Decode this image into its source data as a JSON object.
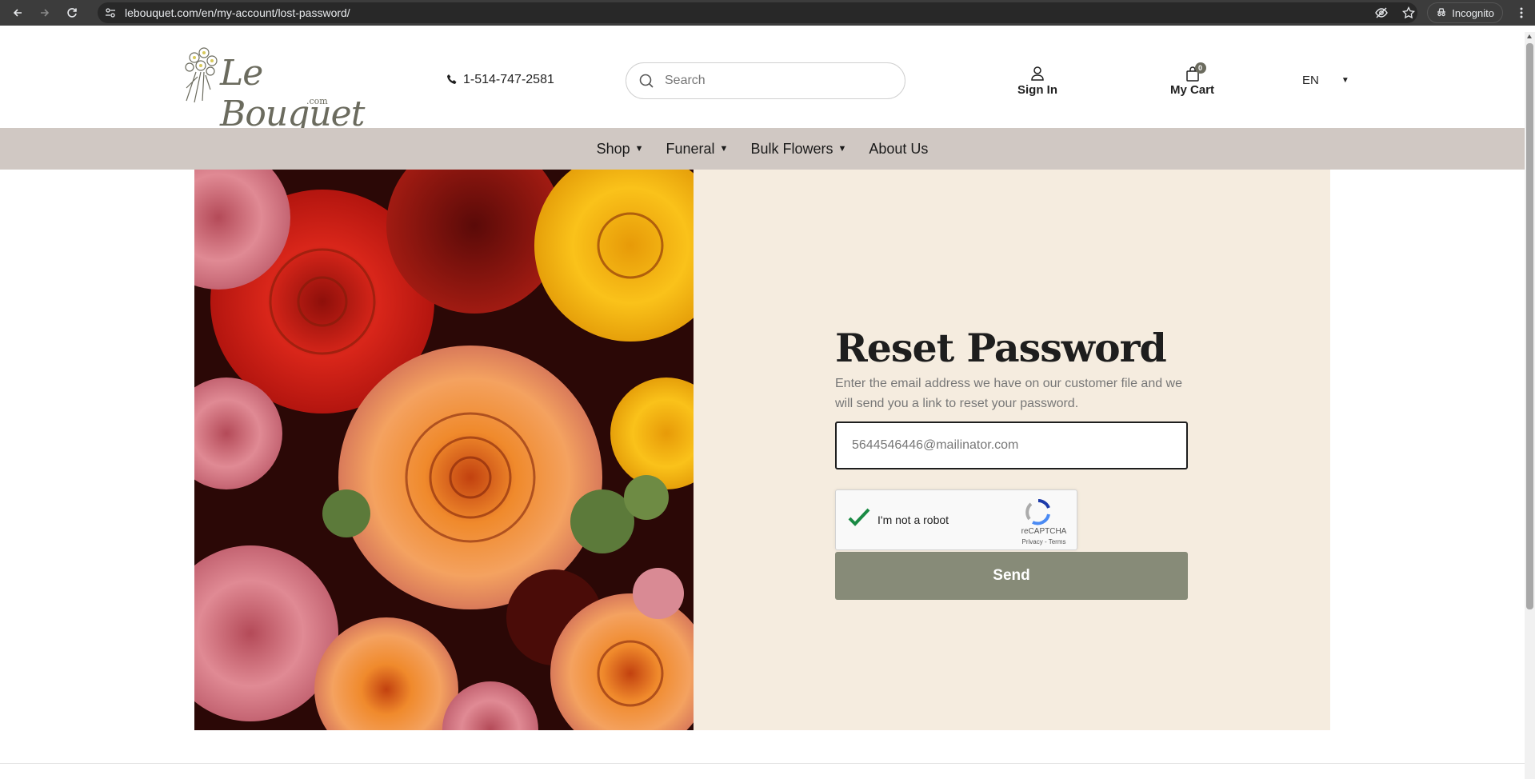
{
  "browser": {
    "url": "lebouquet.com/en/my-account/lost-password/",
    "incognito_label": "Incognito"
  },
  "header": {
    "logo_text": "Le Bouquet",
    "logo_suffix": ".com",
    "phone": "1-514-747-2581",
    "search_placeholder": "Search",
    "signin_label": "Sign In",
    "cart_label": "My Cart",
    "cart_count": "0",
    "language": "EN"
  },
  "nav": {
    "items": [
      {
        "label": "Shop"
      },
      {
        "label": "Funeral"
      },
      {
        "label": "Bulk Flowers"
      },
      {
        "label": "About Us"
      }
    ]
  },
  "form": {
    "title": "Reset Password",
    "description": "Enter the email address we have on our customer file and we will send you a link to reset your password.",
    "email_value": "5644546446@mailinator.com",
    "captcha_label": "I'm not a robot",
    "captcha_brand": "reCAPTCHA",
    "captcha_links": "Privacy - Terms",
    "send_label": "Send"
  },
  "colors": {
    "panel_bg": "#f5ecdf",
    "nav_bg": "#d0c8c3",
    "send_bg": "#878b78",
    "logo": "#6b6b5e"
  },
  "icons": [
    "back-icon",
    "forward-icon",
    "reload-icon",
    "site-info-icon",
    "eye-off-icon",
    "star-icon",
    "incognito-icon",
    "menu-icon",
    "phone-icon",
    "search-icon",
    "user-icon",
    "bag-icon",
    "caret-down-icon",
    "checkmark-icon",
    "recaptcha-icon"
  ]
}
